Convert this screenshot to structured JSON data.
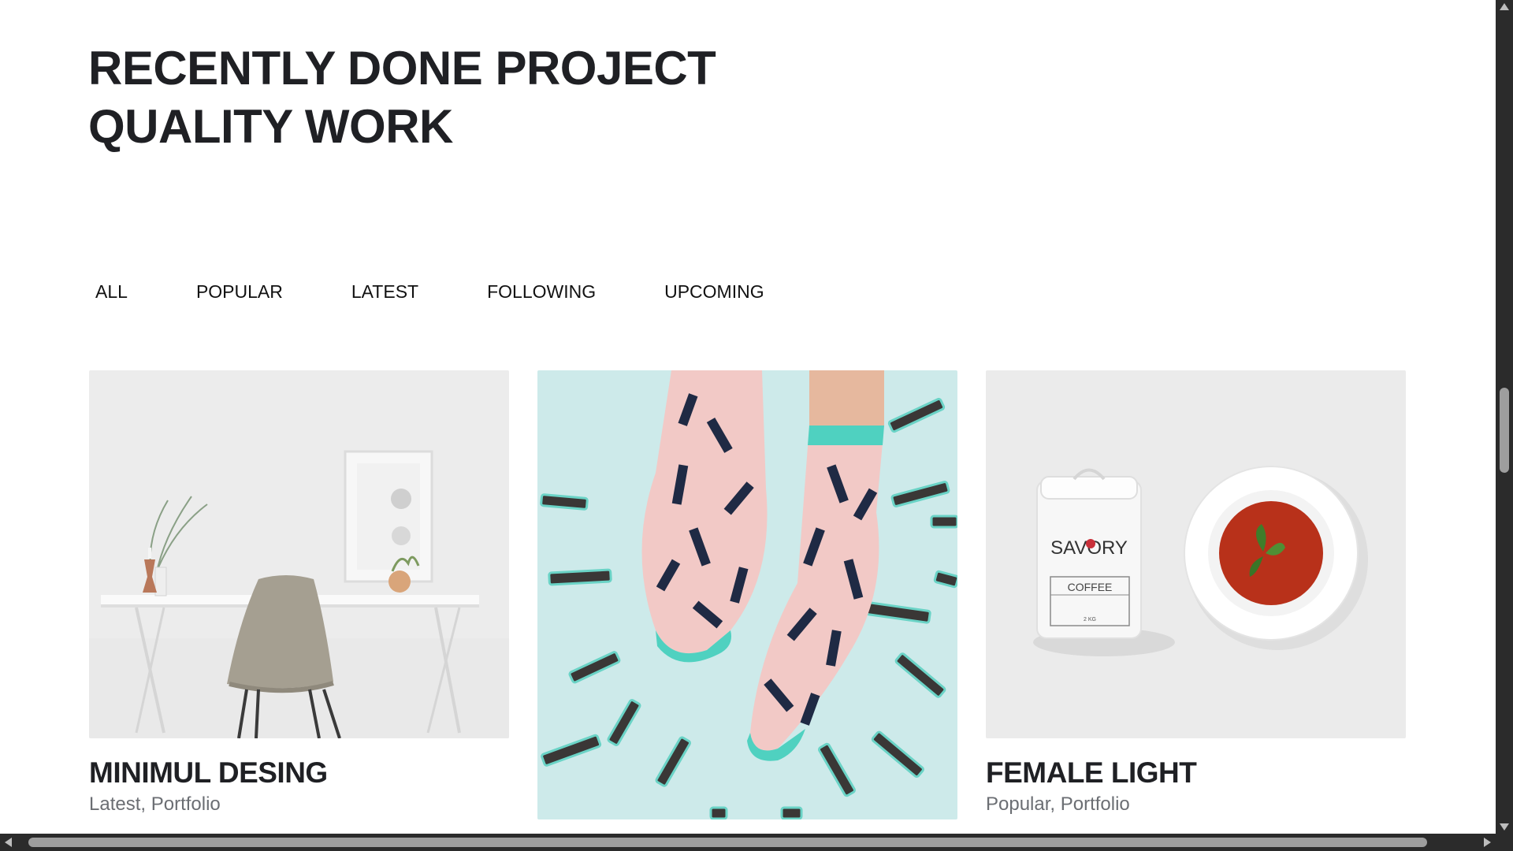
{
  "section": {
    "heading_line1": "RECENTLY DONE PROJECT",
    "heading_line2": "QUALITY WORK"
  },
  "filters": [
    {
      "label": "ALL"
    },
    {
      "label": "POPULAR"
    },
    {
      "label": "LATEST"
    },
    {
      "label": "FOLLOWING"
    },
    {
      "label": "UPCOMING"
    }
  ],
  "projects": [
    {
      "title": "MINIMUL DESING",
      "meta": "Latest, Portfolio",
      "image": "desk-chair-photo"
    },
    {
      "title": "",
      "meta": "",
      "image": "patterned-socks-photo"
    },
    {
      "title": "FEMALE LIGHT",
      "meta": "Popular, Portfolio",
      "image": "savory-coffee-soup-photo"
    }
  ],
  "packaging_text": {
    "brand": "SAVORY",
    "label": "COFFEE",
    "weight": "2 KG"
  },
  "colors": {
    "heading": "#1f2024",
    "meta": "#6b6e73",
    "socks_bg": "#cdeaea",
    "teal": "#4fd1c0",
    "sock_pink": "#f3c8c8",
    "soup": "#b8311a"
  }
}
